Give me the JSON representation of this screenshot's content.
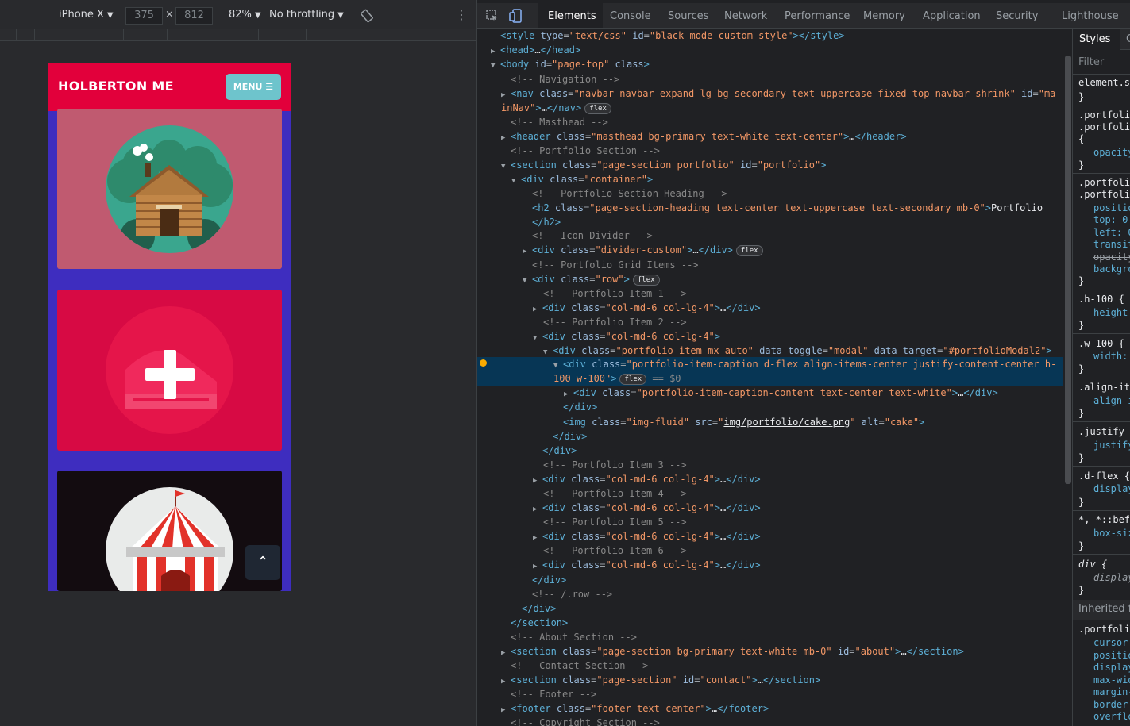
{
  "device_toolbar": {
    "device": "iPhone X",
    "width": "375",
    "times": "×",
    "height": "812",
    "zoom": "82%",
    "throttling": "No throttling"
  },
  "phone": {
    "brand": "HOLBERTON ME",
    "menu_label": "MENU",
    "menu_icon": "hamburger-icon",
    "scroll_top_icon": "chevron-up-icon",
    "scroll_top_glyph": "⌃",
    "cards": [
      {
        "name": "cabin",
        "icon": "log-cabin-icon",
        "color": "#c05a70"
      },
      {
        "name": "cake",
        "icon": "cake-icon",
        "color": "#d70a44"
      },
      {
        "name": "circus",
        "icon": "circus-tent-icon",
        "color": "#130c10"
      }
    ]
  },
  "devtools": {
    "tabs": [
      "Elements",
      "Console",
      "Sources",
      "Network",
      "Performance",
      "Memory",
      "Application",
      "Security",
      "Lighthouse"
    ],
    "active_tab": "Elements"
  },
  "dom": {
    "flex_badge": "flex",
    "sel_marker": "== $0",
    "ellipsis": "…",
    "c_navigation": "<!-- Navigation -->",
    "c_masthead": "<!-- Masthead -->",
    "c_portfolio_section": "<!-- Portfolio Section -->",
    "c_portfolio_heading": "<!-- Portfolio Section Heading -->",
    "c_icon_divider": "<!-- Icon Divider -->",
    "c_grid_items": "<!-- Portfolio Grid Items -->",
    "c_item_1": "<!-- Portfolio Item 1 -->",
    "c_item_2": "<!-- Portfolio Item 2 -->",
    "c_item_3": "<!-- Portfolio Item 3 -->",
    "c_item_4": "<!-- Portfolio Item 4 -->",
    "c_item_5": "<!-- Portfolio Item 5 -->",
    "c_item_6": "<!-- Portfolio Item 6 -->",
    "c_row_end": "<!-- /.row -->",
    "c_about": "<!-- About Section -->",
    "c_contact": "<!-- Contact Section -->",
    "c_footer": "<!-- Footer -->",
    "c_copyright": "<!-- Copyright Section -->",
    "heading_text": "Portfolio",
    "img_src": "img/portfolio/cake.png"
  },
  "styles_pane": {
    "tab_styles": "Styles",
    "tab_next": "C",
    "filter_placeholder": "Filter",
    "inherited_label": "Inherited fr"
  }
}
